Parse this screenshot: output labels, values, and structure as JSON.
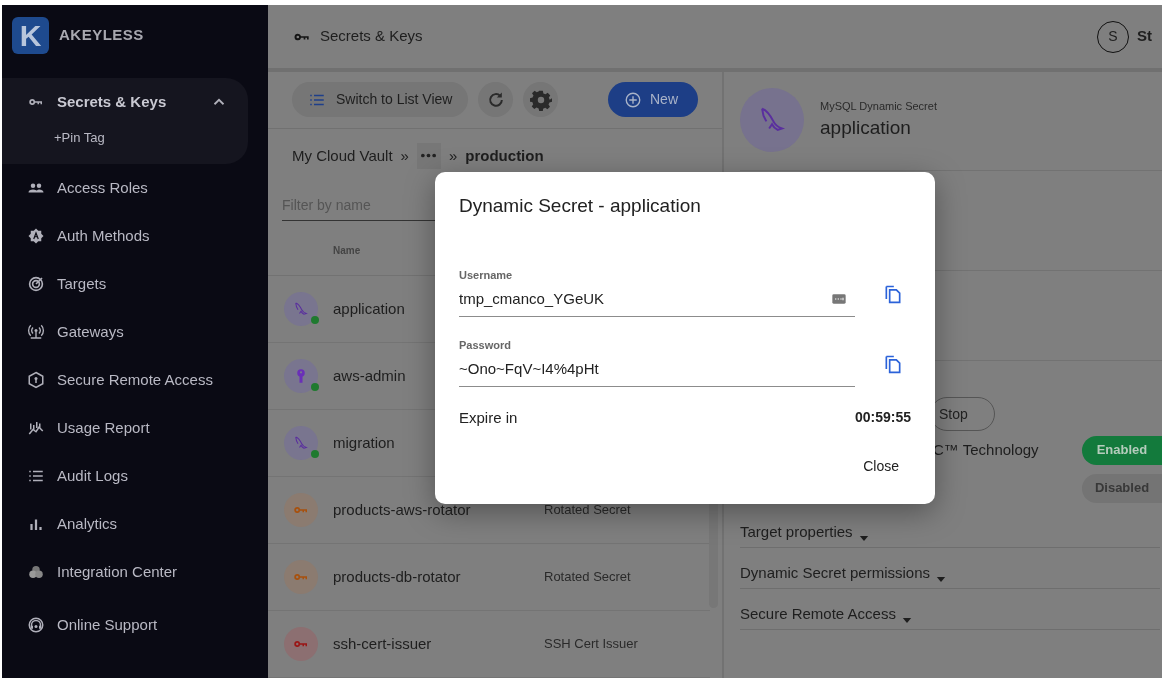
{
  "sidebar": {
    "logo_letter": "K",
    "brand": "AKEYLESS",
    "items": [
      {
        "label": "Secrets & Keys",
        "selected": true,
        "expanded": true,
        "children": [
          {
            "label": "+Pin Tag"
          }
        ]
      },
      {
        "label": "Access Roles",
        "selected": false
      },
      {
        "label": "Auth Methods",
        "selected": false
      },
      {
        "label": "Targets",
        "selected": false
      },
      {
        "label": "Gateways",
        "selected": false
      },
      {
        "label": "Secure Remote Access",
        "selected": false
      },
      {
        "label": "Usage Report",
        "selected": false
      },
      {
        "label": "Audit Logs",
        "selected": false
      },
      {
        "label": "Analytics",
        "selected": false
      },
      {
        "label": "Integration Center",
        "selected": false
      },
      {
        "label": "Online Support",
        "selected": false
      }
    ]
  },
  "header": {
    "title": "Secrets & Keys",
    "user_initial": "S",
    "user_name": "St"
  },
  "toolbar": {
    "view_button": "Switch to List View",
    "new_button": "New"
  },
  "breadcrumb": {
    "root": "My Cloud Vault",
    "separator": "»",
    "current_separator": "»",
    "current": "production"
  },
  "filter": {
    "placeholder": "Filter by name"
  },
  "table": {
    "columns": [
      "Name"
    ],
    "rows": [
      {
        "name": "application",
        "kind": "mysql",
        "active": true
      },
      {
        "name": "aws-admin",
        "kind": "keyhole",
        "active": true
      },
      {
        "name": "migration",
        "kind": "mysql",
        "active": true
      },
      {
        "name": "products-aws-rotator",
        "type": "Rotated Secret",
        "kind": "rotated",
        "active": false
      },
      {
        "name": "products-db-rotator",
        "type": "Rotated Secret",
        "kind": "rotated",
        "active": false
      },
      {
        "name": "ssh-cert-issuer",
        "type": "SSH Cert Issuer",
        "kind": "ssh",
        "active": false
      }
    ]
  },
  "details": {
    "subtitle": "MySQL Dynamic Secret",
    "title": "application",
    "stop_button": "Stop",
    "settings": [
      {
        "label": "C™ Technology",
        "state": "Enabled",
        "on": true
      },
      {
        "state": "Disabled",
        "on": false
      }
    ],
    "sections": [
      "Target properties",
      "Dynamic Secret permissions",
      "Secure Remote Access"
    ]
  },
  "dialog": {
    "title": "Dynamic Secret - application",
    "fields": [
      {
        "label": "Username",
        "value": "tmp_cmanco_YGeUK",
        "keyboard_icon": true
      },
      {
        "label": "Password",
        "value": "~Ono~FqV~I4%4pHt",
        "keyboard_icon": false
      }
    ],
    "expire_label": "Expire in",
    "expire_value": "00:59:55",
    "close_button": "Close"
  }
}
